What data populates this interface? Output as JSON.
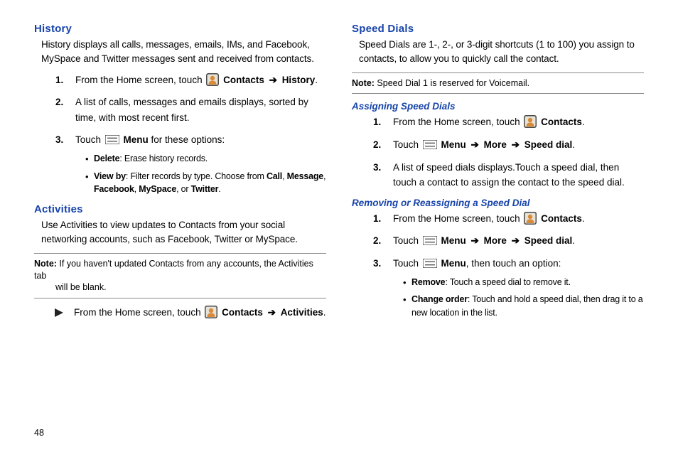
{
  "page_number": "48",
  "left": {
    "history": {
      "heading": "History",
      "intro": "History displays all calls, messages, emails, IMs, and Facebook, MySpace and Twitter messages sent and received from contacts.",
      "steps": {
        "s1_pre": "From the Home screen, touch ",
        "s1_contacts": "Contacts",
        "s1_arrow": " ➔ ",
        "s1_history": "History",
        "s1_end": ".",
        "s2": "A list of calls, messages and emails displays, sorted by time, with most recent first.",
        "s3_pre": "Touch ",
        "s3_menu": "Menu",
        "s3_post": " for these options:"
      },
      "bullets": {
        "b1_bold": "Delete",
        "b1_rest": ": Erase history records.",
        "b2_bold": "View by",
        "b2_pre": ": Filter records by type. Choose from ",
        "b2_call": "Call",
        "b2_c1": ", ",
        "b2_msg": "Message",
        "b2_c2": ", ",
        "b2_fb": "Facebook",
        "b2_c3": ", ",
        "b2_ms": "MySpace",
        "b2_c4": ", or ",
        "b2_tw": "Twitter",
        "b2_end": "."
      }
    },
    "activities": {
      "heading": "Activities",
      "intro": "Use Activities to view updates to Contacts from your social networking accounts, such as Facebook, Twitter or MySpace.",
      "note_label": "Note: ",
      "note_body": "If you haven't updated Contacts from any accounts, the Activities tab will be blank.",
      "play_pre": "From the Home screen, touch ",
      "play_contacts": "Contacts",
      "play_arrow": " ➔ ",
      "play_act": "Activities",
      "play_end": "."
    }
  },
  "right": {
    "speed": {
      "heading": "Speed Dials",
      "intro": "Speed Dials are 1-, 2-, or 3-digit shortcuts (1 to 100) you assign to contacts, to allow you to quickly call the contact.",
      "note_label": "Note: ",
      "note_body": "Speed Dial 1 is reserved for Voicemail."
    },
    "assign": {
      "heading": "Assigning Speed Dials",
      "s1_pre": "From the Home screen, touch ",
      "s1_contacts": "Contacts",
      "s1_end": ".",
      "s2_pre": "Touch ",
      "s2_menu": "Menu",
      "s2_a1": " ➔ ",
      "s2_more": "More",
      "s2_a2": " ➔ ",
      "s2_sd": "Speed dial",
      "s2_end": ".",
      "s3": "A list of speed dials displays.Touch a speed dial, then touch a contact to assign the contact to the speed dial."
    },
    "remove": {
      "heading": "Removing or Reassigning a Speed Dial",
      "s1_pre": "From the Home screen, touch ",
      "s1_contacts": "Contacts",
      "s1_end": ".",
      "s2_pre": "Touch ",
      "s2_menu": "Menu",
      "s2_a1": " ➔ ",
      "s2_more": "More",
      "s2_a2": " ➔ ",
      "s2_sd": "Speed dial",
      "s2_end": ".",
      "s3_pre": "Touch ",
      "s3_menu": "Menu",
      "s3_post": ", then touch an option:",
      "bullets": {
        "b1_bold": "Remove",
        "b1_rest": ": Touch a speed dial to remove it.",
        "b2_bold": "Change order",
        "b2_rest": ": Touch and hold a speed dial, then drag it to a new location in the list."
      }
    }
  }
}
